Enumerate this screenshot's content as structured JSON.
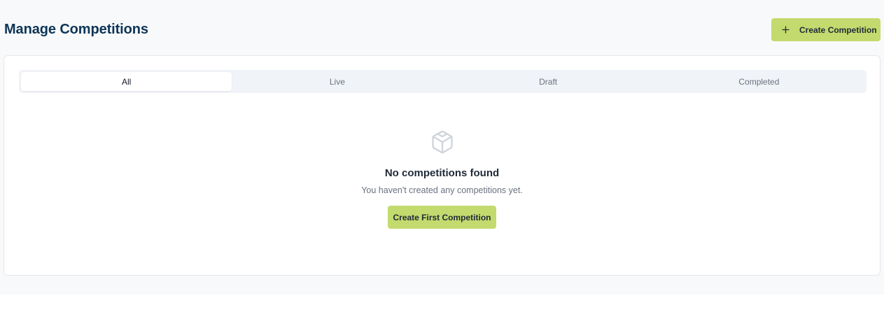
{
  "page": {
    "title": "Manage Competitions"
  },
  "header": {
    "create_button_label": "Create Competition",
    "create_button_icon": "plus-icon"
  },
  "tabs": [
    {
      "label": "All",
      "active": true
    },
    {
      "label": "Live",
      "active": false
    },
    {
      "label": "Draft",
      "active": false
    },
    {
      "label": "Completed",
      "active": false
    }
  ],
  "empty_state": {
    "icon": "box-icon",
    "title": "No competitions found",
    "message": "You haven't created any competitions yet.",
    "button_label": "Create First Competition"
  },
  "colors": {
    "accent": "#c3da6e",
    "title": "#0d3558",
    "background": "#f8f9fa"
  }
}
